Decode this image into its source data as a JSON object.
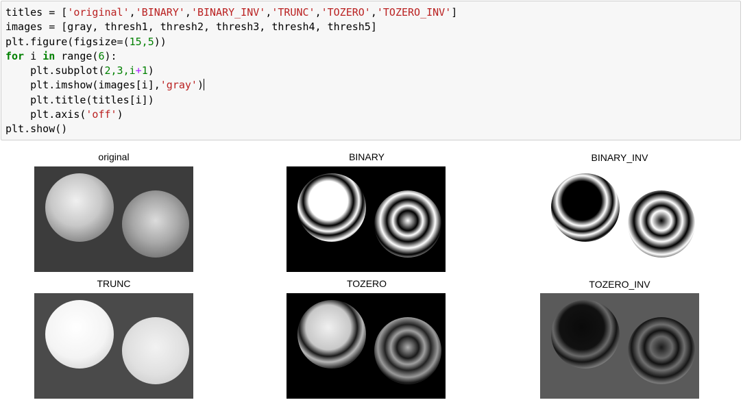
{
  "code": {
    "titles_var": "titles",
    "titles_vals": [
      "'original'",
      "'BINARY'",
      "'BINARY_INV'",
      "'TRUNC'",
      "'TOZERO'",
      "'TOZERO_INV'"
    ],
    "images_line": "images = [gray, thresh1, thresh2, thresh3, thresh4, thresh5]",
    "figure_prefix": "plt.figure(figsize=(",
    "figure_nums": "15,5",
    "for_kw": "for",
    "for_mid": " i ",
    "in_kw": "in",
    "range_fn": " range(",
    "range_num": "6",
    "range_end": "):",
    "subplot_prefix": "    plt.subplot(",
    "subplot_args": "2,3,i",
    "subplot_plus": "+",
    "subplot_one": "1",
    "imshow_prefix": "    plt.imshow(images[i],",
    "imshow_str": "'gray'",
    "title_line": "    plt.title(titles[i])",
    "axis_prefix": "    plt.axis(",
    "axis_str": "'off'",
    "show_line": "plt.show()"
  },
  "panels": [
    {
      "title": "original",
      "style": "original"
    },
    {
      "title": "BINARY",
      "style": "binary"
    },
    {
      "title": "BINARY_INV",
      "style": "binary_inv"
    },
    {
      "title": "TRUNC",
      "style": "trunc"
    },
    {
      "title": "TOZERO",
      "style": "tozero"
    },
    {
      "title": "TOZERO_INV",
      "style": "tozero_inv"
    }
  ]
}
